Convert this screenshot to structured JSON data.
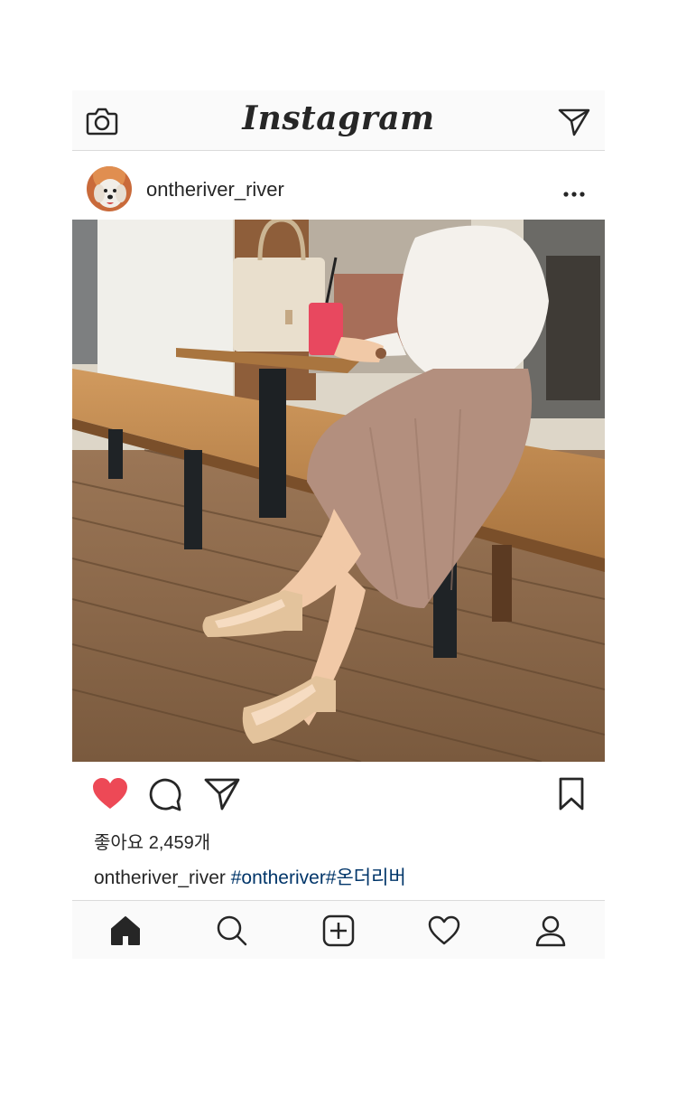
{
  "app": {
    "logo_text": "Instagram"
  },
  "post": {
    "username": "ontheriver_river",
    "likes_text": "좋아요 2,459개",
    "caption_user": "ontheriver_river",
    "caption_tags": "#ontheriver#온더리버",
    "liked": true
  },
  "icons": {
    "camera": "camera-icon",
    "direct": "paper-plane-icon",
    "more": "more-dots-icon",
    "like": "heart-filled-icon",
    "comment": "comment-bubble-icon",
    "share": "paper-plane-icon",
    "save": "bookmark-icon",
    "nav": [
      "home-icon",
      "search-icon",
      "add-post-icon",
      "activity-heart-icon",
      "profile-icon"
    ]
  },
  "colors": {
    "like_red": "#ed4956",
    "hashtag_blue": "#003569",
    "text": "#262626",
    "bar_bg": "#fafafa",
    "divider": "#dbdbdb"
  }
}
